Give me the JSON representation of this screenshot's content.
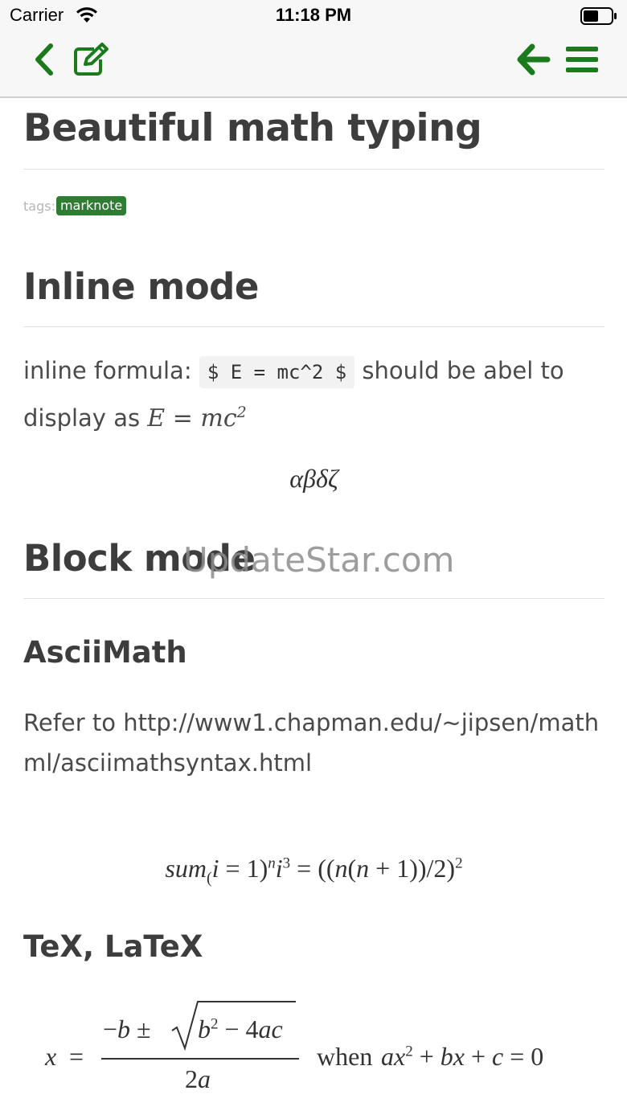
{
  "status_bar": {
    "carrier": "Carrier",
    "time": "11:18 PM"
  },
  "nav": {
    "back_icon": "chevron-left-icon",
    "edit_icon": "edit-square-icon",
    "arrow_icon": "arrow-left-icon",
    "menu_icon": "hamburger-menu-icon",
    "accent_color": "#1b7a1b"
  },
  "doc": {
    "title": "Beautiful math typing",
    "tags_label": "tags:",
    "tags": [
      "marknote"
    ],
    "inline_heading": "Inline mode",
    "inline_text_1": "inline formula: ",
    "inline_code": "$ E = mc^2 $",
    "inline_text_2": " should be abel to display as ",
    "greek": "αβδζ",
    "block_heading": "Block mode",
    "asciimath_heading": "AsciiMath",
    "refer_text": "Refer to http://www1.chapman.edu/~jipsen/mathml/asciimathsyntax.html",
    "tex_heading": "TeX, LaTeX",
    "when_text": "when"
  },
  "watermark": "UpdateStar.com"
}
